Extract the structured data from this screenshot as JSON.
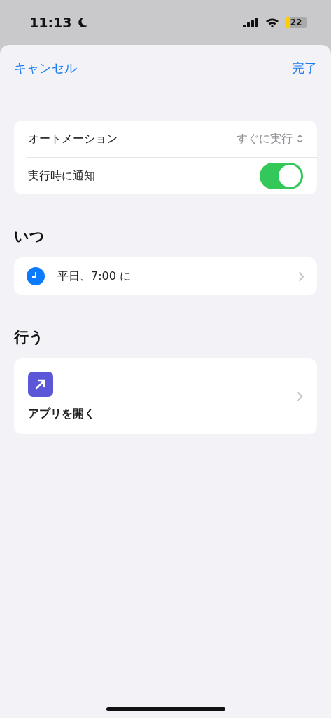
{
  "status_bar": {
    "time": "11:13",
    "battery": "22"
  },
  "nav": {
    "cancel": "キャンセル",
    "done": "完了"
  },
  "settings": [
    {
      "kind": "picker",
      "label": "オートメーション",
      "value": "すぐに実行"
    },
    {
      "kind": "toggle",
      "label": "実行時に通知",
      "on": true
    }
  ],
  "when": {
    "title": "いつ",
    "item": "平日、7:00 に"
  },
  "do": {
    "title": "行う",
    "action": "アプリを開く"
  }
}
